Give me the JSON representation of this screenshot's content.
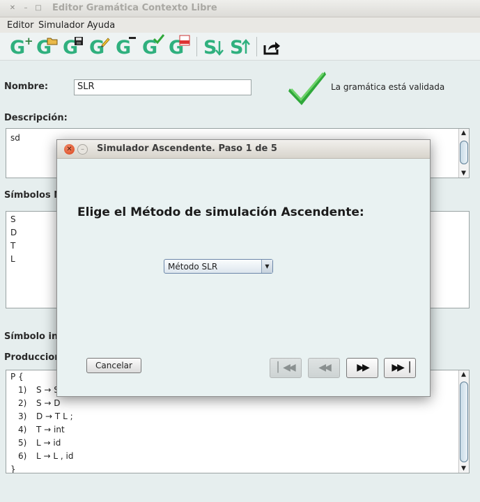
{
  "window": {
    "title": "Editor Gramática Contexto Libre"
  },
  "menu": {
    "items": [
      "Editor",
      "Simulador",
      "Ayuda"
    ]
  },
  "toolbar": {
    "buttons": [
      {
        "name": "new-grammar",
        "letter": "G",
        "badge": "+"
      },
      {
        "name": "open-grammar",
        "letter": "G",
        "badge": "folder"
      },
      {
        "name": "save-grammar",
        "letter": "G",
        "badge": "disk"
      },
      {
        "name": "edit-grammar",
        "letter": "G",
        "badge": "pencil"
      },
      {
        "name": "remove-grammar",
        "letter": "G",
        "badge": "-"
      },
      {
        "name": "validate-grammar",
        "letter": "G",
        "badge": "check"
      },
      {
        "name": "export-pdf",
        "letter": "G",
        "badge": "PDF"
      },
      {
        "name": "simulate-descending",
        "letter": "S",
        "badge": "down-arrow"
      },
      {
        "name": "simulate-ascending",
        "letter": "S",
        "badge": "up-arrow"
      },
      {
        "name": "exit",
        "badge": "share-arrow"
      }
    ]
  },
  "form": {
    "name_label": "Nombre:",
    "name_value": "SLR",
    "validation_text": "La gramática está validada",
    "description_label": "Descripción:",
    "description_value": "sd",
    "nonterminals_label": "Símbolos N",
    "nonterminals": [
      "S",
      "D",
      "T",
      "L"
    ],
    "start_symbol_label": "Símbolo in",
    "productions_label": "Produccion",
    "productions_open": "P {",
    "productions": [
      {
        "num": "1)",
        "text": "S → S"
      },
      {
        "num": "2)",
        "text": "S → D"
      },
      {
        "num": "3)",
        "text": "D → T L ;"
      },
      {
        "num": "4)",
        "text": "T → int"
      },
      {
        "num": "5)",
        "text": "L → id"
      },
      {
        "num": "6)",
        "text": "L → L , id"
      }
    ],
    "productions_close": "}"
  },
  "dialog": {
    "title": "Simulador Ascendente. Paso 1 de 5",
    "heading": "Elige el Método de simulación Ascendente:",
    "method_selected": "Método SLR",
    "cancel_label": "Cancelar",
    "nav_icons": [
      "first-icon",
      "previous-icon",
      "next-icon",
      "last-icon"
    ]
  },
  "colors": {
    "accent_green": "#2fb07e",
    "check_green": "#2fa83a",
    "close_red": "#e0532a"
  }
}
